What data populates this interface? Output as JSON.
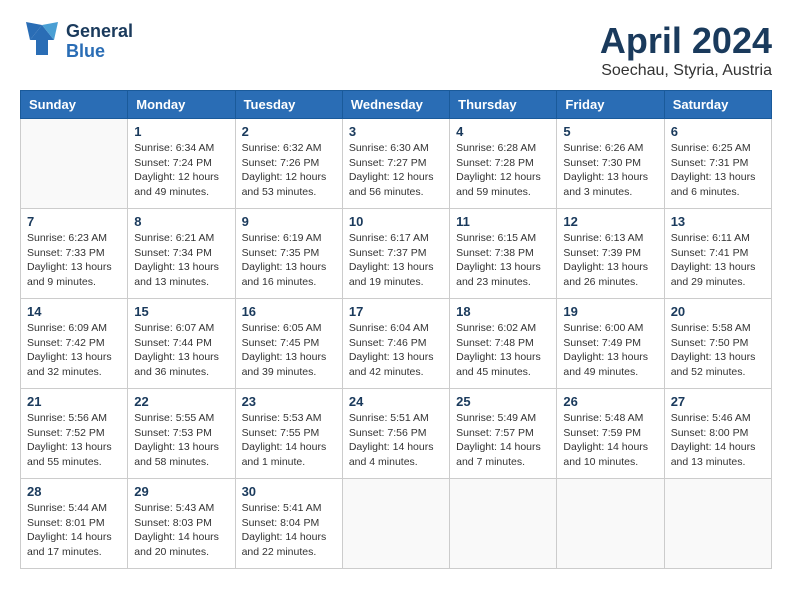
{
  "header": {
    "logo_general": "General",
    "logo_blue": "Blue",
    "month": "April 2024",
    "location": "Soechau, Styria, Austria"
  },
  "weekdays": [
    "Sunday",
    "Monday",
    "Tuesday",
    "Wednesday",
    "Thursday",
    "Friday",
    "Saturday"
  ],
  "weeks": [
    [
      {
        "day": "",
        "info": ""
      },
      {
        "day": "1",
        "info": "Sunrise: 6:34 AM\nSunset: 7:24 PM\nDaylight: 12 hours\nand 49 minutes."
      },
      {
        "day": "2",
        "info": "Sunrise: 6:32 AM\nSunset: 7:26 PM\nDaylight: 12 hours\nand 53 minutes."
      },
      {
        "day": "3",
        "info": "Sunrise: 6:30 AM\nSunset: 7:27 PM\nDaylight: 12 hours\nand 56 minutes."
      },
      {
        "day": "4",
        "info": "Sunrise: 6:28 AM\nSunset: 7:28 PM\nDaylight: 12 hours\nand 59 minutes."
      },
      {
        "day": "5",
        "info": "Sunrise: 6:26 AM\nSunset: 7:30 PM\nDaylight: 13 hours\nand 3 minutes."
      },
      {
        "day": "6",
        "info": "Sunrise: 6:25 AM\nSunset: 7:31 PM\nDaylight: 13 hours\nand 6 minutes."
      }
    ],
    [
      {
        "day": "7",
        "info": "Sunrise: 6:23 AM\nSunset: 7:33 PM\nDaylight: 13 hours\nand 9 minutes."
      },
      {
        "day": "8",
        "info": "Sunrise: 6:21 AM\nSunset: 7:34 PM\nDaylight: 13 hours\nand 13 minutes."
      },
      {
        "day": "9",
        "info": "Sunrise: 6:19 AM\nSunset: 7:35 PM\nDaylight: 13 hours\nand 16 minutes."
      },
      {
        "day": "10",
        "info": "Sunrise: 6:17 AM\nSunset: 7:37 PM\nDaylight: 13 hours\nand 19 minutes."
      },
      {
        "day": "11",
        "info": "Sunrise: 6:15 AM\nSunset: 7:38 PM\nDaylight: 13 hours\nand 23 minutes."
      },
      {
        "day": "12",
        "info": "Sunrise: 6:13 AM\nSunset: 7:39 PM\nDaylight: 13 hours\nand 26 minutes."
      },
      {
        "day": "13",
        "info": "Sunrise: 6:11 AM\nSunset: 7:41 PM\nDaylight: 13 hours\nand 29 minutes."
      }
    ],
    [
      {
        "day": "14",
        "info": "Sunrise: 6:09 AM\nSunset: 7:42 PM\nDaylight: 13 hours\nand 32 minutes."
      },
      {
        "day": "15",
        "info": "Sunrise: 6:07 AM\nSunset: 7:44 PM\nDaylight: 13 hours\nand 36 minutes."
      },
      {
        "day": "16",
        "info": "Sunrise: 6:05 AM\nSunset: 7:45 PM\nDaylight: 13 hours\nand 39 minutes."
      },
      {
        "day": "17",
        "info": "Sunrise: 6:04 AM\nSunset: 7:46 PM\nDaylight: 13 hours\nand 42 minutes."
      },
      {
        "day": "18",
        "info": "Sunrise: 6:02 AM\nSunset: 7:48 PM\nDaylight: 13 hours\nand 45 minutes."
      },
      {
        "day": "19",
        "info": "Sunrise: 6:00 AM\nSunset: 7:49 PM\nDaylight: 13 hours\nand 49 minutes."
      },
      {
        "day": "20",
        "info": "Sunrise: 5:58 AM\nSunset: 7:50 PM\nDaylight: 13 hours\nand 52 minutes."
      }
    ],
    [
      {
        "day": "21",
        "info": "Sunrise: 5:56 AM\nSunset: 7:52 PM\nDaylight: 13 hours\nand 55 minutes."
      },
      {
        "day": "22",
        "info": "Sunrise: 5:55 AM\nSunset: 7:53 PM\nDaylight: 13 hours\nand 58 minutes."
      },
      {
        "day": "23",
        "info": "Sunrise: 5:53 AM\nSunset: 7:55 PM\nDaylight: 14 hours\nand 1 minute."
      },
      {
        "day": "24",
        "info": "Sunrise: 5:51 AM\nSunset: 7:56 PM\nDaylight: 14 hours\nand 4 minutes."
      },
      {
        "day": "25",
        "info": "Sunrise: 5:49 AM\nSunset: 7:57 PM\nDaylight: 14 hours\nand 7 minutes."
      },
      {
        "day": "26",
        "info": "Sunrise: 5:48 AM\nSunset: 7:59 PM\nDaylight: 14 hours\nand 10 minutes."
      },
      {
        "day": "27",
        "info": "Sunrise: 5:46 AM\nSunset: 8:00 PM\nDaylight: 14 hours\nand 13 minutes."
      }
    ],
    [
      {
        "day": "28",
        "info": "Sunrise: 5:44 AM\nSunset: 8:01 PM\nDaylight: 14 hours\nand 17 minutes."
      },
      {
        "day": "29",
        "info": "Sunrise: 5:43 AM\nSunset: 8:03 PM\nDaylight: 14 hours\nand 20 minutes."
      },
      {
        "day": "30",
        "info": "Sunrise: 5:41 AM\nSunset: 8:04 PM\nDaylight: 14 hours\nand 22 minutes."
      },
      {
        "day": "",
        "info": ""
      },
      {
        "day": "",
        "info": ""
      },
      {
        "day": "",
        "info": ""
      },
      {
        "day": "",
        "info": ""
      }
    ]
  ]
}
